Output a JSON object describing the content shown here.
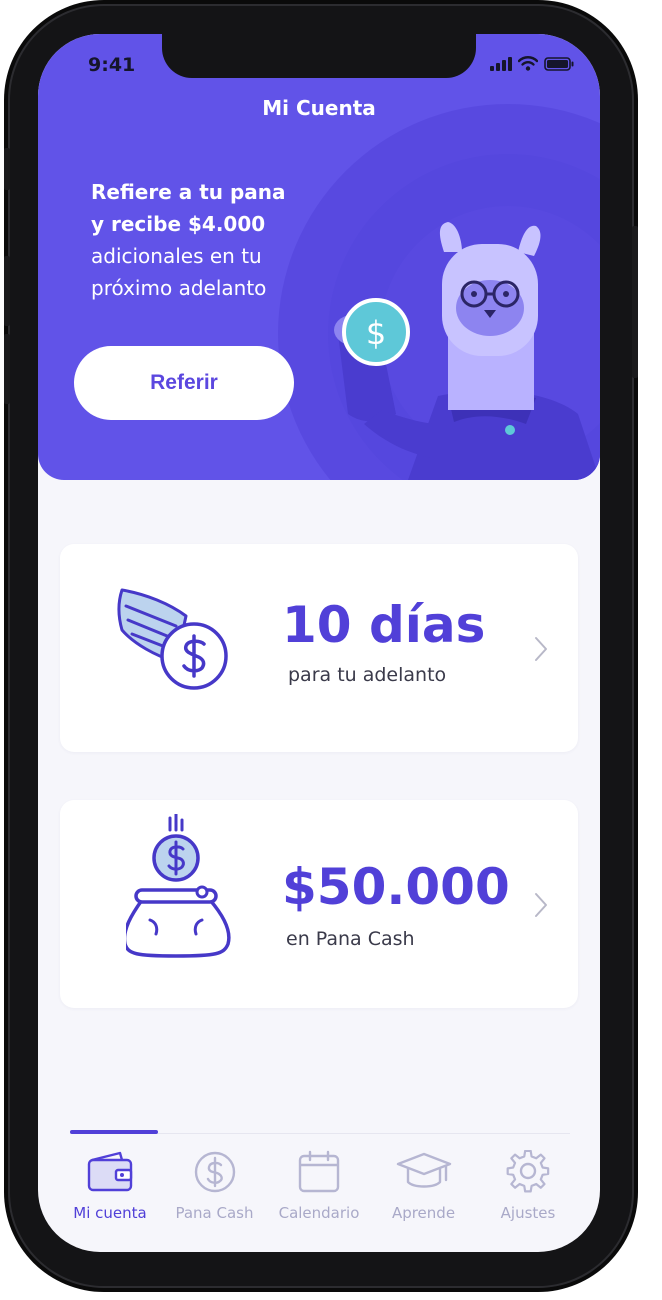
{
  "status_bar": {
    "time": "9:41"
  },
  "header": {
    "title": "Mi Cuenta"
  },
  "promo": {
    "line1": "Refiere a tu pana",
    "line2": "y recibe $4.000",
    "line3": "adicionales en tu",
    "line4": "próximo adelanto",
    "button_label": "Referir"
  },
  "cards": [
    {
      "value": "10 días",
      "caption": "para tu adelanto",
      "icon": "winged-coin-icon"
    },
    {
      "value": "$50.000",
      "caption": "en Pana Cash",
      "icon": "coin-purse-icon"
    }
  ],
  "tabs": [
    {
      "label": "Mi cuenta",
      "icon": "wallet-icon",
      "active": true
    },
    {
      "label": "Pana Cash",
      "icon": "dollar-coin-icon",
      "active": false
    },
    {
      "label": "Calendario",
      "icon": "calendar-icon",
      "active": false
    },
    {
      "label": "Aprende",
      "icon": "graduation-cap-icon",
      "active": false
    },
    {
      "label": "Ajustes",
      "icon": "gear-icon",
      "active": false
    }
  ],
  "colors": {
    "brand_purple": "#6153e8",
    "accent_text": "#5140d8",
    "coin_teal": "#5ec8d8",
    "inactive_tab": "#a9a9c8"
  }
}
